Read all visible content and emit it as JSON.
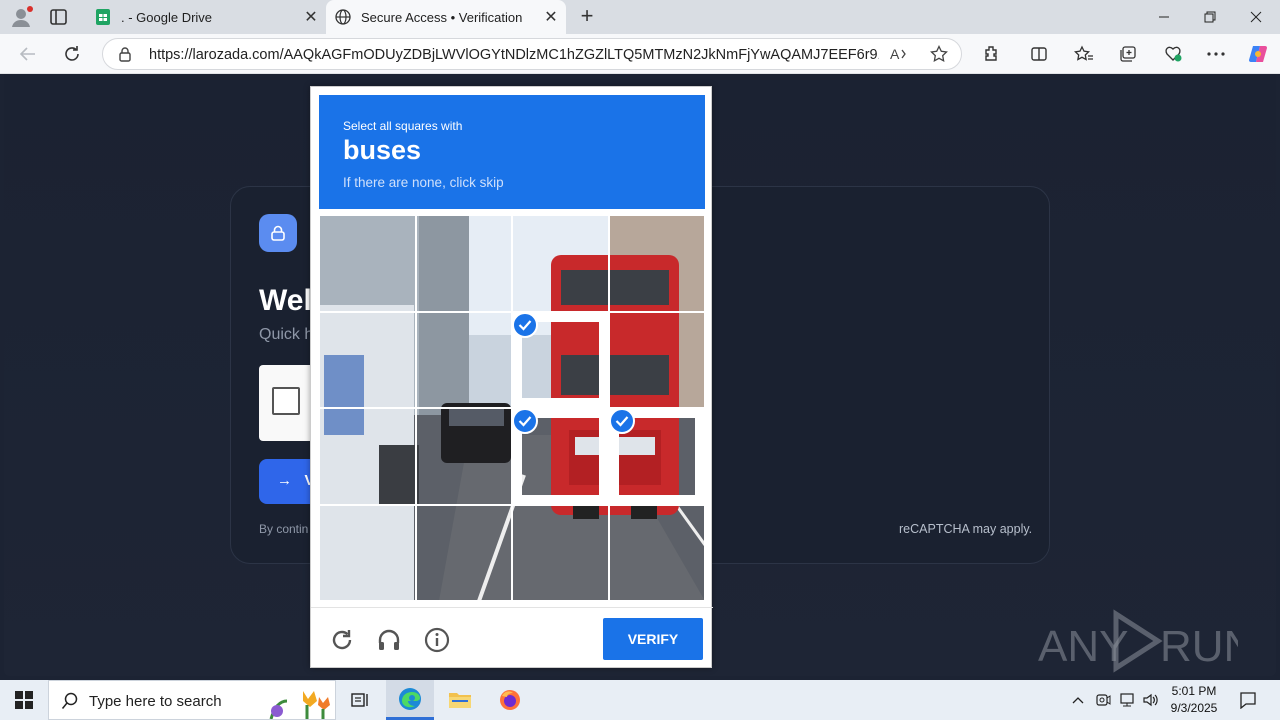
{
  "browser": {
    "tabs": [
      {
        "title": ". - Google Drive",
        "active": false
      },
      {
        "title": "Secure Access • Verification",
        "active": true
      }
    ],
    "url": "https://larozada.com/AAQkAGFmODUyZDBjLWVlOGYtNDlzMC1hZGZlLTQ5MTMzN2JkNmFjYwAQAMJ7EEF6r91Ovo..."
  },
  "page": {
    "welcome": "Wel",
    "quick": "Quick h",
    "verify_short": "V",
    "by_continuing": "By contin",
    "recaptcha_note": "reCAPTCHA may apply."
  },
  "challenge": {
    "line1": "Select all squares with",
    "keyword": "buses",
    "line3": "If there are none, click skip",
    "verify_label": "VERIFY",
    "tiles_selected": [
      6,
      10,
      11
    ]
  },
  "taskbar": {
    "search_placeholder": "Type here to search",
    "time": "5:01 PM",
    "date": "9/3/2025"
  },
  "watermark": "ANY RUN",
  "colors": {
    "accent": "#1a73e8",
    "page_bg": "#1c2333"
  }
}
